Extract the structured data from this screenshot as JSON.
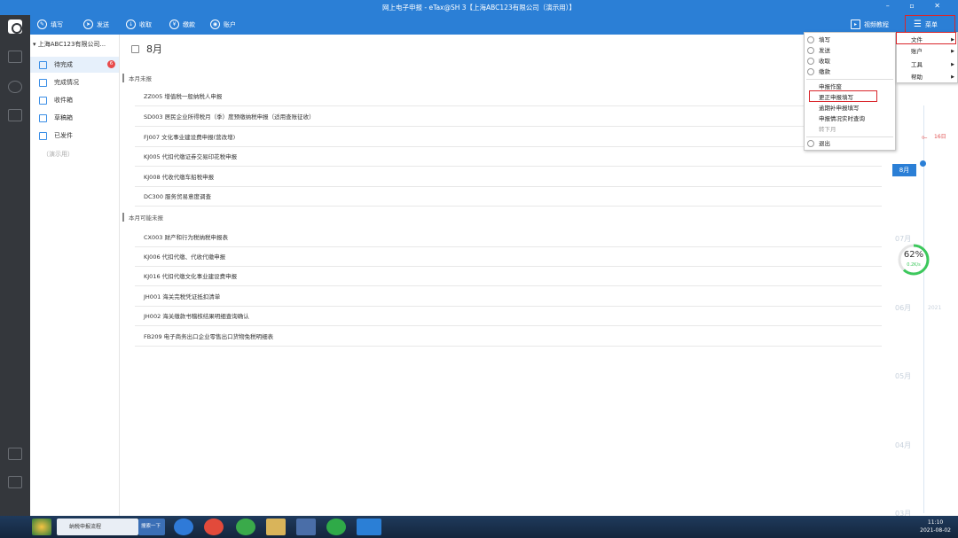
{
  "window": {
    "title": "网上电子申报 - eTax@SH 3【上海ABC123有限公司（演示用）】",
    "controls": "–  ▫  ✕"
  },
  "toolbar": {
    "items": [
      {
        "label": "填写",
        "icon": "fill-icon"
      },
      {
        "label": "发送",
        "icon": "send-icon"
      },
      {
        "label": "收取",
        "icon": "receive-icon"
      },
      {
        "label": "缴款",
        "icon": "payment-icon"
      },
      {
        "label": "账户",
        "icon": "account-icon"
      }
    ],
    "video_tutorial": "视频教程",
    "menu": "菜单"
  },
  "sidebar": {
    "company": "上海ABC123有限公司...",
    "items": [
      {
        "label": "待完成",
        "badge": "6"
      },
      {
        "label": "完成情况"
      },
      {
        "label": "收件箱"
      },
      {
        "label": "草稿箱"
      },
      {
        "label": "已发件"
      }
    ],
    "demo": "（演示用）"
  },
  "main": {
    "month": "8月",
    "sections": [
      {
        "title": "本月未报",
        "rows": [
          "ZZ005 增值税一般纳税人申报",
          "SD003 居民企业所得税月（季）度预缴纳税申报（适用查账征收）",
          "FJ007 文化事业建设费申报(营改增)",
          "KJ005 代扣代缴证券交易印花税申报",
          "KJ008 代收代缴车船税申报",
          "DC300 服务贸易意度调查"
        ]
      },
      {
        "title": "本月可能未报",
        "rows": [
          "CX003 财产和行为税纳税申报表",
          "KJ006 代扣代缴、代收代缴申报",
          "KJ016 代扣代缴文化事业建设费申报",
          "JH001 海关完税凭证抵扣清单",
          "JH002 海关缴款书稽核结果明细查询确认",
          "FB209 电子商务出口企业零售出口货物免税明细表"
        ]
      }
    ]
  },
  "timeline": {
    "today": "16日",
    "current": "8月",
    "months": [
      "07月",
      "06月",
      "05月",
      "04月",
      "03月"
    ],
    "year": "2021",
    "progress_percent": 62,
    "progress_label": "62%",
    "speed": "0.2K/s"
  },
  "menu": {
    "items": [
      "填写",
      "发送",
      "收取",
      "缴款",
      "申报作废",
      "更正申报填写",
      "逾期补申报填写",
      "申报情况实时查询",
      "转下月",
      "退出"
    ]
  },
  "submenu": {
    "items": [
      "文件",
      "账户",
      "工具",
      "帮助"
    ]
  },
  "taskbar": {
    "browser_tab": "纳税申报流程",
    "search": "搜索一下",
    "time": "11:10",
    "date": "2021-08-02"
  },
  "colors": {
    "brand": "#2b7fd6",
    "highlight": "#d9262b",
    "badge": "#e84b4b",
    "progress": "#3cc85c"
  }
}
